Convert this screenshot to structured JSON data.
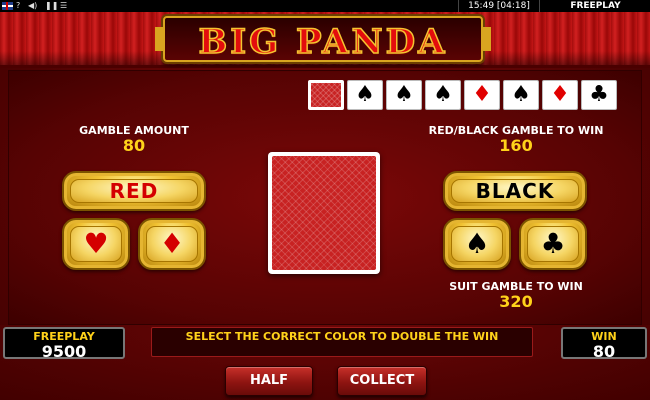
{
  "status_bar": {
    "time": "15:49 [04:18]",
    "mode": "FREEPLAY",
    "icons": [
      "uk-flag-icon",
      "question-icon",
      "sound-icon",
      "pause-icon",
      "menu-icon"
    ]
  },
  "game": {
    "title": "BIG PANDA",
    "history_cards": [
      {
        "kind": "back",
        "suit": "",
        "color": "red"
      },
      {
        "kind": "card",
        "suit": "♠",
        "color": "black"
      },
      {
        "kind": "card",
        "suit": "♠",
        "color": "black"
      },
      {
        "kind": "card",
        "suit": "♠",
        "color": "black"
      },
      {
        "kind": "card",
        "suit": "♦",
        "color": "red"
      },
      {
        "kind": "card",
        "suit": "♠",
        "color": "black"
      },
      {
        "kind": "card",
        "suit": "♦",
        "color": "red"
      },
      {
        "kind": "card",
        "suit": "♣",
        "color": "black"
      }
    ]
  },
  "gamble": {
    "amount_label": "GAMBLE AMOUNT",
    "amount_value": "80",
    "redblack_label": "RED/BLACK GAMBLE TO WIN",
    "redblack_value": "160",
    "suit_label": "SUIT GAMBLE TO WIN",
    "suit_value": "320",
    "red_label": "RED",
    "black_label": "BLACK",
    "suits": {
      "heart": "♥",
      "diamond": "♦",
      "spade": "♠",
      "club": "♣"
    }
  },
  "footer": {
    "freeplay_label": "FREEPLAY",
    "freeplay_value": "9500",
    "message": "SELECT THE CORRECT COLOR TO DOUBLE THE WIN",
    "win_label": "WIN",
    "win_value": "80",
    "half_label": "HALF",
    "collect_label": "COLLECT"
  },
  "colors": {
    "accent_gold": "#ffd21a",
    "red_suit": "#d40000",
    "background": "#5e0404"
  }
}
